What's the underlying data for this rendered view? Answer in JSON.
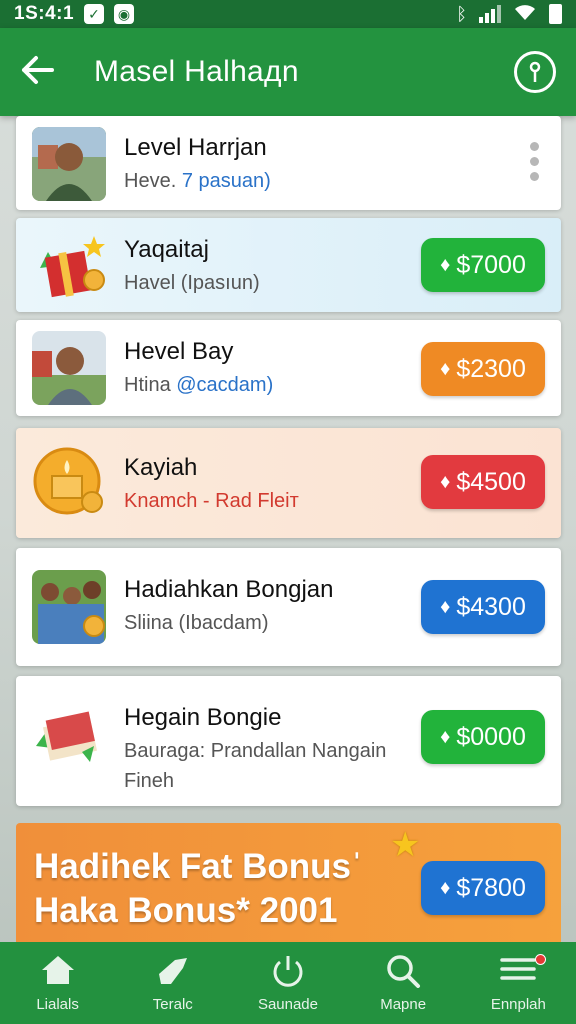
{
  "status_bar": {
    "time": "1S:4:1"
  },
  "app_bar": {
    "title": "Masel Halhaдn"
  },
  "items": [
    {
      "title": "Level Harrjan",
      "subtitle_a": "Heve. ",
      "subtitle_b": "7 pasuan)",
      "price": ""
    },
    {
      "title": "Yaqaitaj",
      "subtitle_a": "Havel (Ipasıun)",
      "subtitle_b": "",
      "price": "$7000",
      "color": "#22b33b"
    },
    {
      "title": "Hevel Bay",
      "subtitle_a": "Htina ",
      "subtitle_b": "@cacdam)",
      "price": "$2300",
      "color": "#ef8a24"
    },
    {
      "title": "Kayiah",
      "subtitle_a": "Knamch - Rad Fleiт",
      "subtitle_b": "",
      "price": "$4500",
      "color": "#e23a3f"
    },
    {
      "title": "Hadiahkan Bongjan",
      "subtitle_a": "Sliina (Ibacdam)",
      "subtitle_b": "",
      "price": "$4300",
      "color": "#1f73d2"
    },
    {
      "title": "Hegain Bongie",
      "subtitle_a": "Bauraga: Prandallan Nangain",
      "subtitle_b": "Fineh",
      "price": "$0000",
      "color": "#22b33b"
    }
  ],
  "promo": {
    "line1": "Hadihek Fat Bonusˈ",
    "line2": "Haka Bonus* 2001",
    "price": "$7800"
  },
  "nav": [
    {
      "label": "Lialals",
      "icon": "home-icon"
    },
    {
      "label": "Teralc",
      "icon": "megaphone-icon"
    },
    {
      "label": "Saunade",
      "icon": "power-icon"
    },
    {
      "label": "Mapne",
      "icon": "search-icon"
    },
    {
      "label": "Ennplah",
      "icon": "menu-icon"
    }
  ],
  "colors": {
    "primary": "#23933f",
    "status": "#1b6f33"
  }
}
